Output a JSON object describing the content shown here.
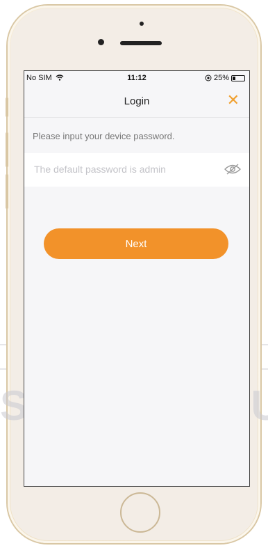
{
  "status_bar": {
    "carrier": "No SIM",
    "time": "11:12",
    "battery": "25%",
    "battery_level": 0.25
  },
  "nav": {
    "title": "Login",
    "close_label": "✕"
  },
  "form": {
    "prompt": "Please input your device password.",
    "password_placeholder": "The default password is admin",
    "password_value": "",
    "next_label": "Next"
  },
  "watermark": {
    "text": "SECURE YOU",
    "stars": "★★★★★★★"
  },
  "colors": {
    "accent": "#f2922a",
    "close": "#f0a030"
  },
  "icons": [
    "wifi-icon",
    "location-icon",
    "battery-icon",
    "close-icon",
    "eye-hidden-icon"
  ]
}
